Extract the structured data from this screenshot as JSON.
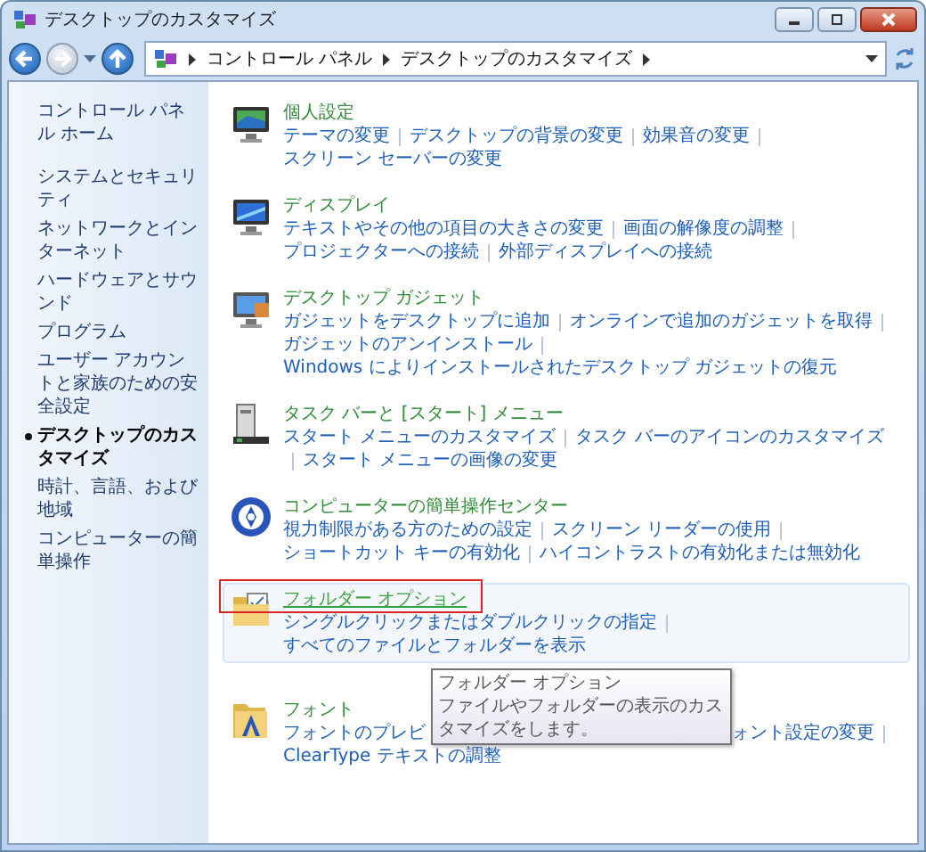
{
  "window": {
    "title": "デスクトップのカスタマイズ"
  },
  "address_bar": {
    "breadcrumbs": [
      "コントロール パネル",
      "デスクトップのカスタマイズ"
    ]
  },
  "sidebar": {
    "home": "コントロール パネル ホーム",
    "items": [
      {
        "label": "システムとセキュリティ",
        "selected": false
      },
      {
        "label": "ネットワークとインターネット",
        "selected": false
      },
      {
        "label": "ハードウェアとサウンド",
        "selected": false
      },
      {
        "label": "プログラム",
        "selected": false
      },
      {
        "label": "ユーザー アカウントと家族のための安全設定",
        "selected": false
      },
      {
        "label": "デスクトップのカスタマイズ",
        "selected": true
      },
      {
        "label": "時計、言語、および地域",
        "selected": false
      },
      {
        "label": "コンピューターの簡単操作",
        "selected": false
      }
    ]
  },
  "sections": [
    {
      "title": "個人設定",
      "highlighted": false,
      "marked": false,
      "links": [
        {
          "kind": "link",
          "text": "テーマの変更"
        },
        {
          "kind": "link",
          "text": "デスクトップの背景の変更"
        },
        {
          "kind": "link",
          "text": "効果音の変更"
        },
        {
          "kind": "link",
          "text": "スクリーン セーバーの変更"
        }
      ]
    },
    {
      "title": "ディスプレイ",
      "highlighted": false,
      "marked": false,
      "links": [
        {
          "kind": "link",
          "text": "テキストやその他の項目の大きさの変更"
        },
        {
          "kind": "link",
          "text": "画面の解像度の調整"
        },
        {
          "kind": "link",
          "text": "プロジェクターへの接続"
        },
        {
          "kind": "link",
          "text": "外部ディスプレイへの接続"
        }
      ]
    },
    {
      "title": "デスクトップ ガジェット",
      "highlighted": false,
      "marked": false,
      "links": [
        {
          "kind": "link",
          "text": "ガジェットをデスクトップに追加"
        },
        {
          "kind": "link",
          "text": "オンラインで追加のガジェットを取得"
        },
        {
          "kind": "link",
          "text": "ガジェットのアンインストール"
        },
        {
          "kind": "link",
          "text": "Windows によりインストールされたデスクトップ ガジェットの復元"
        }
      ]
    },
    {
      "title": "タスク バーと [スタート] メニュー",
      "highlighted": false,
      "marked": false,
      "links": [
        {
          "kind": "link",
          "text": "スタート メニューのカスタマイズ"
        },
        {
          "kind": "link",
          "text": "タスク バーのアイコンのカスタマイズ"
        },
        {
          "kind": "link",
          "text": "スタート メニューの画像の変更"
        }
      ]
    },
    {
      "title": "コンピューターの簡単操作センター",
      "highlighted": false,
      "marked": false,
      "links": [
        {
          "kind": "link",
          "text": "視力制限がある方のための設定"
        },
        {
          "kind": "link",
          "text": "スクリーン リーダーの使用"
        },
        {
          "kind": "link",
          "text": "ショートカット キーの有効化"
        },
        {
          "kind": "link",
          "text": "ハイコントラストの有効化または無効化"
        }
      ]
    },
    {
      "title": "フォルダー オプション",
      "highlighted": true,
      "marked": true,
      "links": [
        {
          "kind": "link",
          "text": "シングルクリックまたはダブルクリックの指定"
        },
        {
          "kind": "link",
          "text": "すべてのファイルとフォルダーを表示"
        }
      ]
    },
    {
      "title": "フォント",
      "highlighted": false,
      "marked": false,
      "links": [
        {
          "kind": "link",
          "text": "フォントのプレビ"
        },
        {
          "kind": "tooltip",
          "title": "フォルダー オプション",
          "text": "ファイルやフォルダーの表示のカスタマイズをします。"
        },
        {
          "kind": "link",
          "text": "ォント設定の変更"
        },
        {
          "kind": "link",
          "text": "ClearType テキストの調整"
        }
      ]
    }
  ]
}
